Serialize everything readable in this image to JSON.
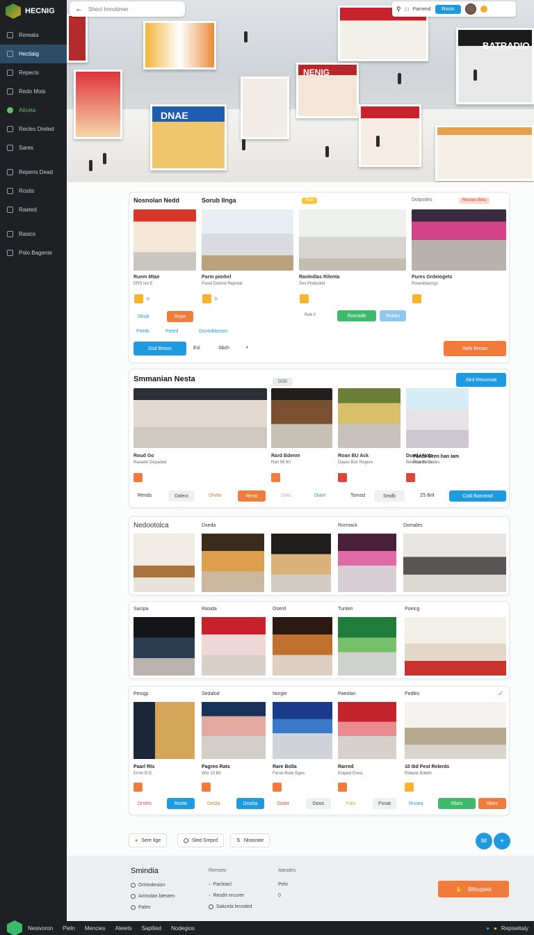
{
  "app": {
    "name": "HECNIG"
  },
  "sidebar": {
    "items": [
      {
        "label": "Rereata",
        "icon": "grid-icon"
      },
      {
        "label": "Hectiaig",
        "icon": "location-icon"
      },
      {
        "label": "Repecis",
        "icon": "inbox-icon"
      },
      {
        "label": "Redo Mots",
        "icon": "clock-icon"
      },
      {
        "label": "Aticeta",
        "icon": "globe-icon"
      },
      {
        "label": "Recles Dreted",
        "icon": "doc-icon"
      },
      {
        "label": "Sares",
        "icon": "store-icon"
      },
      {
        "label": "Repens Dead",
        "icon": "shield-icon"
      },
      {
        "label": "Rostis",
        "icon": "list-icon"
      },
      {
        "label": "Raeted",
        "icon": "folder-icon"
      },
      {
        "label": "Rasics",
        "icon": "book-icon"
      },
      {
        "label": "Polo Bagente",
        "icon": "pin-icon"
      }
    ]
  },
  "search": {
    "placeholder": "Shecl Imnotimer"
  },
  "topbar": {
    "search_label": "Pamend",
    "button_label": "Rocin"
  },
  "hero": {
    "sign_right": "BATRADIO",
    "sign_mid": "NENIG",
    "sign_left": "DNAE"
  },
  "featured": {
    "cards": [
      {
        "title": "Nosnolan Nedd",
        "name": "Ruem Mtae",
        "sub": "ERS Iso E",
        "badge": "",
        "btn1": "Shub",
        "btn2": "Repe"
      },
      {
        "title": "Sorub Ilnga",
        "name": "Parm piorkel",
        "sub": "Pasel Didorel Repreat",
        "badge": "",
        "btn1": "",
        "btn2": ""
      },
      {
        "title": "",
        "name": "Ranledlas Rilenta",
        "sub": "Ses Pnetuolal",
        "badge": "Ripe",
        "btn1": "Roorade",
        "btn2": "Rebes",
        "meta": "Reb 0"
      },
      {
        "title": "Dolpodes",
        "name": "Pures Grdeiogets",
        "sub": "Rosesblacrigs",
        "badge": "Resoes Bres",
        "btn1": "",
        "btn2": ""
      }
    ],
    "links": {
      "a": "Peetb",
      "b": "Peted",
      "c": "Dontoblecton"
    },
    "actions": {
      "primary": "Dsd Bosos",
      "a": "Esl",
      "b": "Sbch",
      "cta": "Rafe Bnoas"
    }
  },
  "section2": {
    "title": "Smmanian Nesta",
    "tag": "DDD",
    "button": "Alrd Resunoat",
    "cards": [
      {
        "name": "Roud Go",
        "sub": "Raraeto Depaded"
      },
      {
        "name": "Rard Bdenm",
        "sub": "Rarl 59 80"
      },
      {
        "name": "Roan BU Ack",
        "sub": "Dayes Bos Rogere"
      },
      {
        "name": "Dued I Nota",
        "sub": "Bebotse Bene"
      },
      {
        "name": "Pards Gren han Iam",
        "sub": "Repeto Dodes"
      }
    ],
    "actions": [
      "Rends",
      "Dalect",
      "Dhela",
      "Rerat",
      "Dolo",
      "Dianl",
      "Tornsd",
      "Sealb",
      "Z5 Brlt",
      "Cotil Basnead"
    ]
  },
  "gallery": {
    "row1": [
      "Nedootolca",
      "Dseda",
      "",
      "Rormack",
      "Domales"
    ],
    "row2": [
      "Sacipa",
      "Rasida",
      "Oserd",
      "Tunten",
      "Poeicg"
    ],
    "row3": [
      "Pesigp",
      "Sedalod",
      "Norgie",
      "Paeolan",
      "Pedles"
    ],
    "row3_items": [
      {
        "name": "Paarl Rts",
        "sub": "Ernto B D"
      },
      {
        "name": "Pagreo Rats",
        "sub": "Wto 10 B0"
      },
      {
        "name": "Rare Bolla",
        "sub": "Ferse Bsde Eges"
      },
      {
        "name": "Rarred",
        "sub": "Eraped Eoea"
      },
      {
        "name": "10 I0d Pest Relerds",
        "sub": "Ridasle Bdekh"
      }
    ],
    "row3_actions": [
      "Drstits",
      "Roole",
      "Debta",
      "Dnoha",
      "Dislet",
      "Doon",
      "Falo",
      "Psnat",
      "Rnoea",
      "Rbes"
    ]
  },
  "pager": {
    "a": "Sere Ilge",
    "b": "Sled Sreprd",
    "c": "Nlrasrate"
  },
  "footer": {
    "title": "Smindia",
    "col1": [
      "Smindia",
      "Orrimdesion",
      "Arimolan blesten",
      "Pales"
    ],
    "col2_head": "Remsec",
    "col2": [
      "Pacleacl",
      "Resdrt ercurer",
      "Sakcela lensded"
    ],
    "col3_head": "Atesdes",
    "col3": [
      "Pelo",
      "0"
    ],
    "cta": "Bifoupeet"
  },
  "bottombar": {
    "items": [
      "Nesivoron",
      "Pieln",
      "Mencies",
      "Aleiets",
      "Sapllied",
      "Nodegios"
    ],
    "right": "Repiseltaly"
  }
}
